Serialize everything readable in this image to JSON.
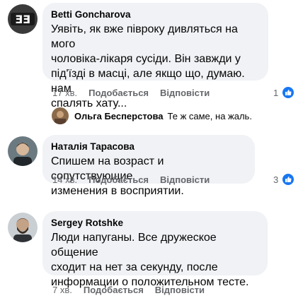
{
  "comments": [
    {
      "author": "Betti Goncharova",
      "text": "Уявіть, як вже півроку дивляться на мого\nчоловіка-лікаря сусіди. Він завжди у\nпід'їзді в масці, але якщо що, думаю. нам\nспалять хату...",
      "time": "17 хв.",
      "like_label": "Подобається",
      "reply_label": "Відповісти",
      "reaction_count": "1",
      "reaction_icon": "like-icon",
      "reply_preview": {
        "author": "Ольга Бесперстова",
        "text": "Те ж саме, на жаль."
      }
    },
    {
      "author": "Наталія Тарасова",
      "text": "Спишем на возраст и сопутствующие\nизменения в восприятии.",
      "time": "14 хв.",
      "like_label": "Подобається",
      "reply_label": "Відповісти",
      "reaction_count": "3",
      "reaction_icon": "like-icon"
    },
    {
      "author": "Sergey  Rotshke",
      "text": "Люди напуганы. Все дружеское общение\nсходит на нет за секунду, после\nинформации о положительном тесте.",
      "time": "7 хв.",
      "like_label": "Подобається",
      "reply_label": "Відповісти"
    }
  ],
  "colors": {
    "bubble": "#f0f2f5",
    "secondary_text": "#65676b",
    "like_blue": "#1877f2"
  }
}
